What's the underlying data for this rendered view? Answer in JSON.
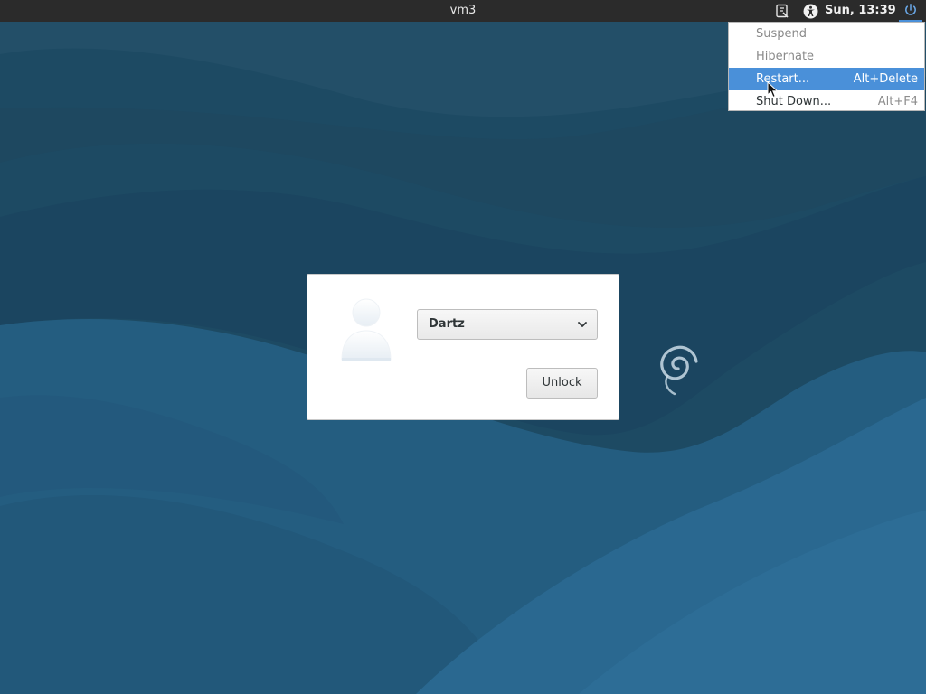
{
  "panel": {
    "host_title": "vm3",
    "clock": "Sun, 13:39",
    "icons": [
      "keyboard-layout-icon",
      "accessibility-icon",
      "power-icon"
    ]
  },
  "power_menu": {
    "items": [
      {
        "label": "Suspend",
        "accelerator": "",
        "state": "disabled"
      },
      {
        "label": "Hibernate",
        "accelerator": "",
        "state": "disabled"
      },
      {
        "label": "Restart...",
        "accelerator": "Alt+Delete",
        "state": "selected"
      },
      {
        "label": "Shut Down...",
        "accelerator": "Alt+F4",
        "state": "enabled"
      }
    ]
  },
  "lock_dialog": {
    "user_select_value": "Dartz",
    "unlock_label": "Unlock"
  },
  "colors": {
    "panel_bg": "#2b2b2b",
    "wallpaper_base": "#1f4d66",
    "menu_selection": "#4a90d9"
  }
}
